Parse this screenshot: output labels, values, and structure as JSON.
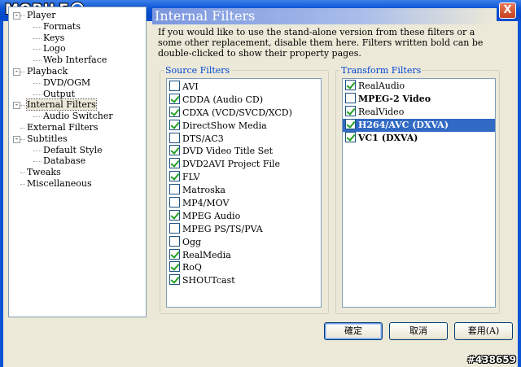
{
  "window": {
    "logo_text": "MOBILE",
    "close_label": "X"
  },
  "tree": [
    {
      "label": "Player",
      "level": 1,
      "expander": "-"
    },
    {
      "label": "Formats",
      "level": 2
    },
    {
      "label": "Keys",
      "level": 2
    },
    {
      "label": "Logo",
      "level": 2
    },
    {
      "label": "Web Interface",
      "level": 2
    },
    {
      "label": "Playback",
      "level": 1,
      "expander": "-"
    },
    {
      "label": "DVD/OGM",
      "level": 2
    },
    {
      "label": "Output",
      "level": 2
    },
    {
      "label": "Internal Filters",
      "level": 1,
      "expander": "-",
      "selected": true
    },
    {
      "label": "Audio Switcher",
      "level": 2
    },
    {
      "label": "External Filters",
      "level": 1
    },
    {
      "label": "Subtitles",
      "level": 1,
      "expander": "-"
    },
    {
      "label": "Default Style",
      "level": 2
    },
    {
      "label": "Database",
      "level": 2
    },
    {
      "label": "Tweaks",
      "level": 1
    },
    {
      "label": "Miscellaneous",
      "level": 1
    }
  ],
  "panel": {
    "title": "Internal Filters",
    "description": "If you would like to use the stand-alone version from these filters or a some other replacement, disable them here. Filters written bold can be double-clicked to show their property pages."
  },
  "source_filters": {
    "legend": "Source Filters",
    "items": [
      {
        "label": "AVI",
        "checked": false
      },
      {
        "label": "CDDA (Audio CD)",
        "checked": true
      },
      {
        "label": "CDXA (VCD/SVCD/XCD)",
        "checked": true
      },
      {
        "label": "DirectShow Media",
        "checked": true
      },
      {
        "label": "DTS/AC3",
        "checked": false
      },
      {
        "label": "DVD Video Title Set",
        "checked": true
      },
      {
        "label": "DVD2AVI Project File",
        "checked": true
      },
      {
        "label": "FLV",
        "checked": true
      },
      {
        "label": "Matroska",
        "checked": false
      },
      {
        "label": "MP4/MOV",
        "checked": false
      },
      {
        "label": "MPEG Audio",
        "checked": true
      },
      {
        "label": "MPEG PS/TS/PVA",
        "checked": false
      },
      {
        "label": "Ogg",
        "checked": false
      },
      {
        "label": "RealMedia",
        "checked": true
      },
      {
        "label": "RoQ",
        "checked": true
      },
      {
        "label": "SHOUTcast",
        "checked": true
      }
    ]
  },
  "transform_filters": {
    "legend": "Transform Filters",
    "items": [
      {
        "label": "RealAudio",
        "checked": true,
        "bold": false
      },
      {
        "label": "MPEG-2 Video",
        "checked": false,
        "bold": true
      },
      {
        "label": "RealVideo",
        "checked": true,
        "bold": false
      },
      {
        "label": "H264/AVC (DXVA)",
        "checked": true,
        "bold": true,
        "selected": true
      },
      {
        "label": "VC1 (DXVA)",
        "checked": true,
        "bold": true
      }
    ]
  },
  "buttons": {
    "ok": "確定",
    "cancel": "取消",
    "apply": "套用(A)"
  },
  "watermark": "#438659",
  "colors": {
    "title_bar": "#0a55d6",
    "selection": "#316ac5",
    "group_legend": "#0046d5",
    "check": "#21a121"
  }
}
